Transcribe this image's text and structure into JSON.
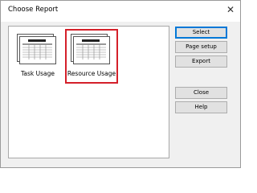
{
  "window": {
    "title": "Choose Report",
    "close_glyph": "✕",
    "close_icon": "close-icon"
  },
  "reports": [
    {
      "label": "Task Usage",
      "icon": "report-thumbnail-icon",
      "selected": false
    },
    {
      "label": "Resource Usage",
      "icon": "report-thumbnail-icon",
      "selected": true
    }
  ],
  "buttons": {
    "select": "Select",
    "page_setup": "Page setup",
    "export": "Export",
    "close": "Close",
    "help": "Help"
  },
  "colors": {
    "selection": "#d4202a",
    "window_bg": "#f0f0f0",
    "list_bg": "#ffffff"
  }
}
